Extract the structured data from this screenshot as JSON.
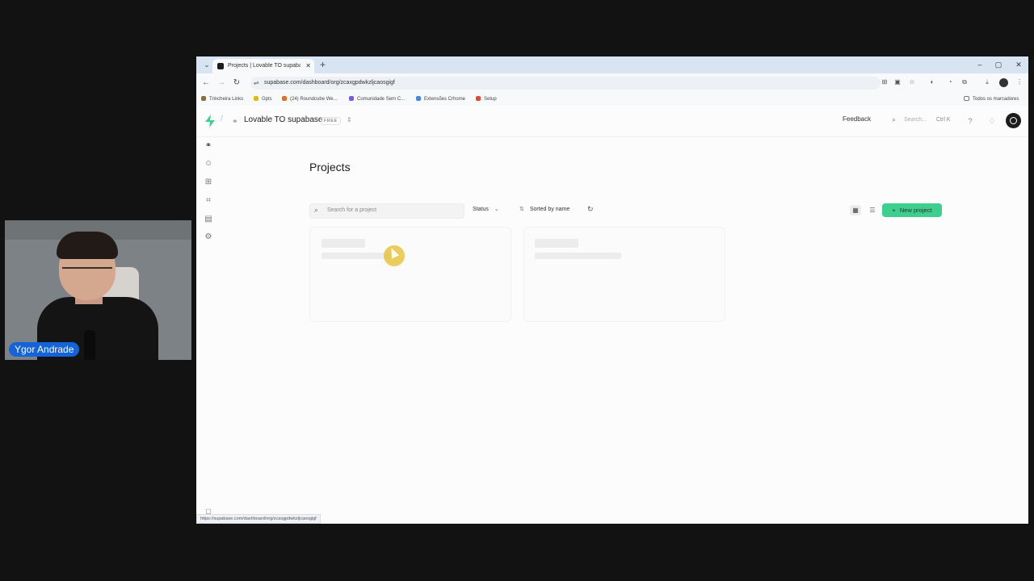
{
  "browser": {
    "tab_title": "Projects | Lovable TO supabase",
    "tab_close": "✕",
    "new_tab": "+",
    "url": "supabase.com/dashboard/org/zcaxgpdwkzljcaosgigf",
    "window_controls": {
      "minimize": "–",
      "maximize": "▢",
      "close": "✕"
    },
    "bookmarks": [
      {
        "label": "Trincheira Links",
        "color": "#8a6d3b"
      },
      {
        "label": "Gpts",
        "color": "#e6b800"
      },
      {
        "label": "(24) Roundcube We...",
        "color": "#e07020"
      },
      {
        "label": "Comunidade Sem C...",
        "color": "#7b5cd6"
      },
      {
        "label": "Extensões Crhome",
        "color": "#4285f4"
      },
      {
        "label": "Setup",
        "color": "#e04a2f"
      }
    ],
    "all_bookmarks": "Todos os marcadores",
    "status_url": "https://supabase.com/dashboard/org/zcaxgpdwkzljcaosgigf"
  },
  "topbar": {
    "org_name": "Lovable TO supabase",
    "plan_badge": "FREE",
    "feedback": "Feedback",
    "search_placeholder": "Search...",
    "search_shortcut": "Ctrl K"
  },
  "main": {
    "title": "Projects",
    "search_placeholder": "Search for a project",
    "status_filter": "Status",
    "sort_label": "Sorted by name",
    "new_project": "New project"
  },
  "webcam": {
    "name": "Ygor Andrade"
  },
  "colors": {
    "brand": "#3ecf8e",
    "badge_blue": "#1463d9"
  }
}
